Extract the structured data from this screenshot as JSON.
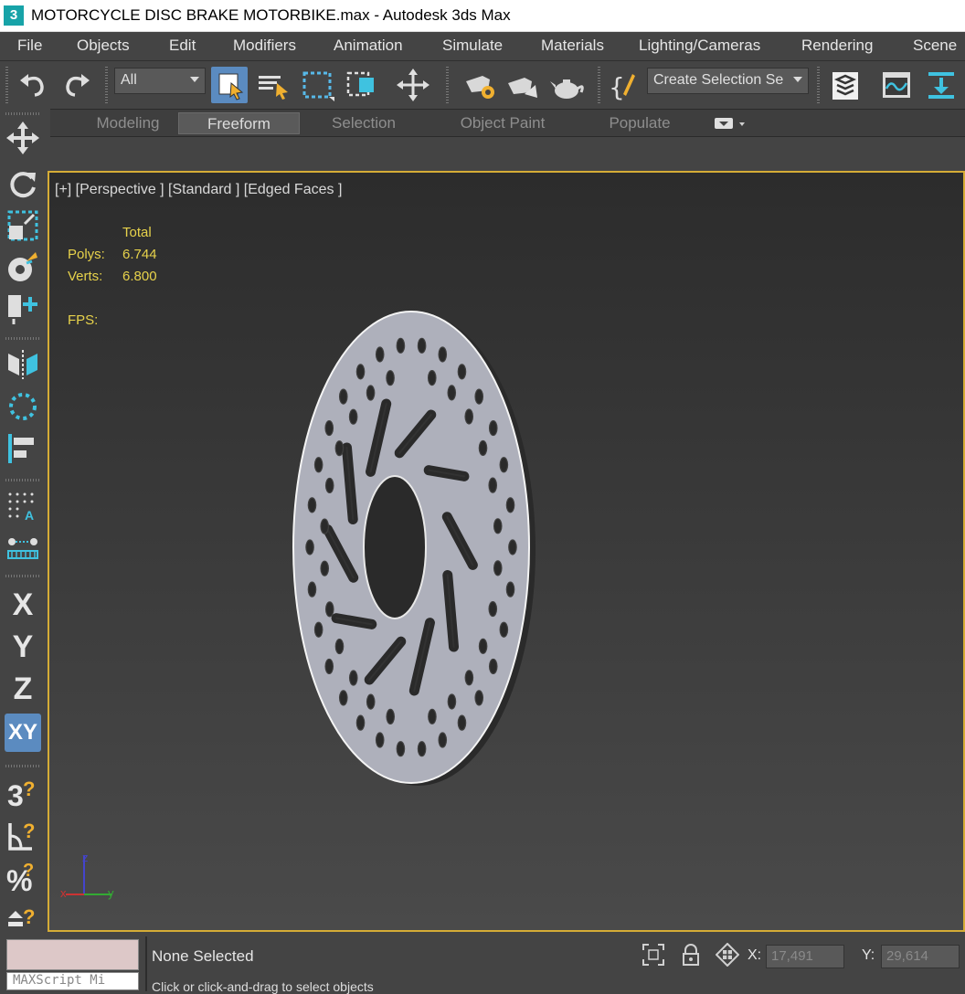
{
  "window": {
    "app_icon": "3",
    "title": "MOTORCYCLE DISC BRAKE MOTORBIKE.max - Autodesk 3ds Max"
  },
  "menu": [
    "File",
    "Objects",
    "Edit",
    "Modifiers",
    "Animation",
    "Simulate",
    "Materials",
    "Lighting/Cameras",
    "Rendering",
    "Scene"
  ],
  "toolbar": {
    "selection_filter": "All",
    "named_selection": "Create Selection Se",
    "icons": [
      "undo-icon",
      "redo-icon",
      "select-object-icon",
      "select-by-name-icon",
      "rectangular-selection-icon",
      "window-crossing-icon",
      "select-and-move-icon",
      "render-setup-icon",
      "render-frame-icon",
      "render-teapot-icon",
      "curly-brace-edit-icon",
      "layer-explorer-icon",
      "curve-editor-icon",
      "dock-icon"
    ]
  },
  "ribbon": {
    "tabs": [
      "Modeling",
      "Freeform",
      "Selection",
      "Object Paint",
      "Populate"
    ],
    "active_tab": "Freeform",
    "options_icon": "ribbon-options-icon"
  },
  "left_toolbar": {
    "axis_x": "X",
    "axis_y": "Y",
    "axis_z": "Z",
    "axis_xy": "XY",
    "icons": [
      "move-icon",
      "rotate-icon",
      "scale-icon",
      "placement-icon",
      "align-icon",
      "mirror-icon",
      "array-icon",
      "align-tools-icon",
      "snap-grid-icon",
      "distribute-icon",
      "snap-3d-icon",
      "angle-snap-icon",
      "percent-snap-icon",
      "spinner-snap-icon"
    ]
  },
  "viewport": {
    "label": "[+] [Perspective ] [Standard ] [Edged Faces ]",
    "stats": {
      "header": "Total",
      "polys_label": "Polys:",
      "polys_value": "6.744",
      "verts_label": "Verts:",
      "verts_value": "6.800",
      "fps_label": "FPS:"
    },
    "axis_labels": {
      "x": "x",
      "y": "y",
      "z": "z"
    },
    "colors": {
      "border": "#d5ac36",
      "stats": "#e7d24b",
      "disc": "#aeb0bb"
    }
  },
  "statusbar": {
    "maxscript_label": "MAXScript Mi",
    "selection_status": "None Selected",
    "prompt": "Click or click-and-drag to select objects",
    "x_label": "X:",
    "x_value": "17,491",
    "y_label": "Y:",
    "y_value": "29,614"
  }
}
